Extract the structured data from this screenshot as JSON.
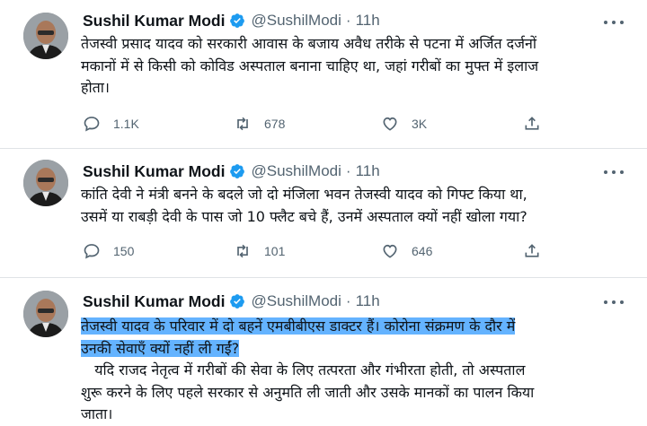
{
  "tweets": [
    {
      "name": "Sushil Kumar Modi",
      "handle": "@SushilModi",
      "separator": "·",
      "time": "11h",
      "lines": [
        "तेजस्वी प्रसाद यादव को सरकारी आवास के बजाय अवैध तरीके से पटना में अर्जित दर्जनों",
        "मकानों में से किसी को कोविड अस्पताल बनाना चाहिए था, जहां गरीबों का मुफ्त में इलाज",
        "होता।"
      ],
      "replies": "1.1K",
      "retweets": "678",
      "likes": "3K"
    },
    {
      "name": "Sushil Kumar Modi",
      "handle": "@SushilModi",
      "separator": "·",
      "time": "11h",
      "lines": [
        "कांति देवी ने मंत्री बनने के बदले जो दो मंजिला भवन तेजस्वी यादव को गिफ्ट किया था,",
        "उसमें या राबड़ी देवी के पास जो 10 फ्लैट बचे हैं, उनमें अस्पताल क्यों नहीं खोला गया?"
      ],
      "replies": "150",
      "retweets": "101",
      "likes": "646"
    },
    {
      "name": "Sushil Kumar Modi",
      "handle": "@SushilModi",
      "separator": "·",
      "time": "11h",
      "lines": [
        "तेजस्वी यादव के परिवार में दो बहनें एमबीबीएस डाक्टर हैं। कोरोना संक्रमण के दौर में",
        "उनकी सेवाएँ क्यों नहीं ली गईं?",
        "   यदि राजद नेतृत्व में गरीबों की सेवा के लिए तत्परता और गंभीरता होती, तो अस्पताल",
        "शुरू करने के लिए पहले सरकार से अनुमति ली जाती और उसके मानकों का पालन किया",
        "जाता।"
      ]
    }
  ],
  "icons": {
    "verified": "verified-badge-icon",
    "more": "more-options-icon",
    "reply": "reply-icon",
    "retweet": "retweet-icon",
    "like": "like-icon",
    "share": "share-icon"
  },
  "colors": {
    "text": "#0f1419",
    "secondary": "#536471",
    "verified": "#1d9bf0",
    "highlight": "#64b3ff",
    "divider": "#dfe3e6"
  }
}
